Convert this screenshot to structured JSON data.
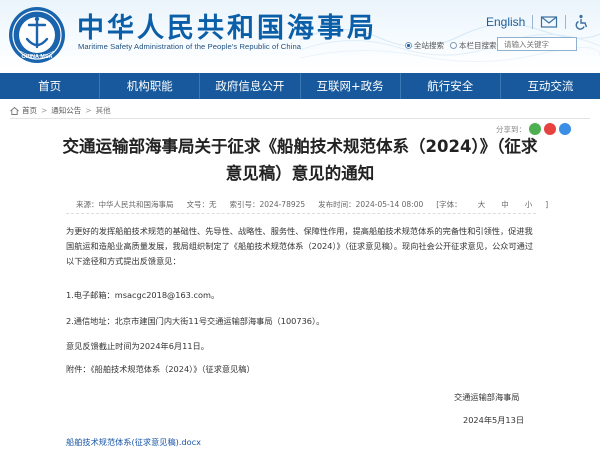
{
  "header": {
    "site_title": "中华人民共和国海事局",
    "site_subtitle": "Maritime Safety Administration of the People's Republic of China",
    "logo_text": "CHINA MSA",
    "lang_link": "English",
    "search_scope_options": [
      "全站搜索",
      "本栏目搜索"
    ],
    "search_placeholder": "请输入关键字"
  },
  "nav": {
    "items": [
      "首页",
      "机构职能",
      "政府信息公开",
      "互联网+政务",
      "航行安全",
      "互动交流"
    ]
  },
  "breadcrumb": [
    "首页",
    "通知公告",
    "其他"
  ],
  "share": {
    "label": "分享到："
  },
  "article": {
    "title": "交通运输部海事局关于征求《船舶技术规范体系（2024）》（征求意见稿）意见的通知",
    "meta": {
      "source": "来源：中华人民共和国海事局",
      "doc_no": "文号：无",
      "index_no": "索引号：2024-78925",
      "publish_time": "发布时间：2024-05-14 08:00",
      "font_label": "[字体：",
      "font_large": "大",
      "font_medium": "中",
      "font_small": "小",
      "font_end": "]"
    },
    "paragraph1": "为更好的发挥船舶技术规范的基础性、先导性、战略性、服务性、保障性作用，提高船舶技术规范体系的完备性和引领性，促进我国航运和造船业高质量发展，我局组织制定了《船舶技术规范体系（2024）》（征求意见稿）。现向社会公开征求意见，公众可通过以下途径和方式提出反馈意见：",
    "paragraph2": "1.电子邮箱：msacgc2018@163.com。",
    "paragraph3": "2.通信地址：北京市建国门内大街11号交通运输部海事局（100736）。",
    "paragraph4": "意见反馈截止时间为2024年6月11日。",
    "paragraph5": "附件：《船舶技术规范体系（2024）》（征求意见稿）",
    "signature": "交通运输部海事局",
    "date": "2024年5月13日",
    "attachment_link": "船舶技术规范体系(征求意见稿).docx"
  },
  "colors": {
    "brand_blue": "#0b5fa8",
    "nav_bg": "#17599c",
    "wechat_green": "#4caf50",
    "weibo_red": "#e64340",
    "qzone_blue": "#3a8ee6"
  }
}
